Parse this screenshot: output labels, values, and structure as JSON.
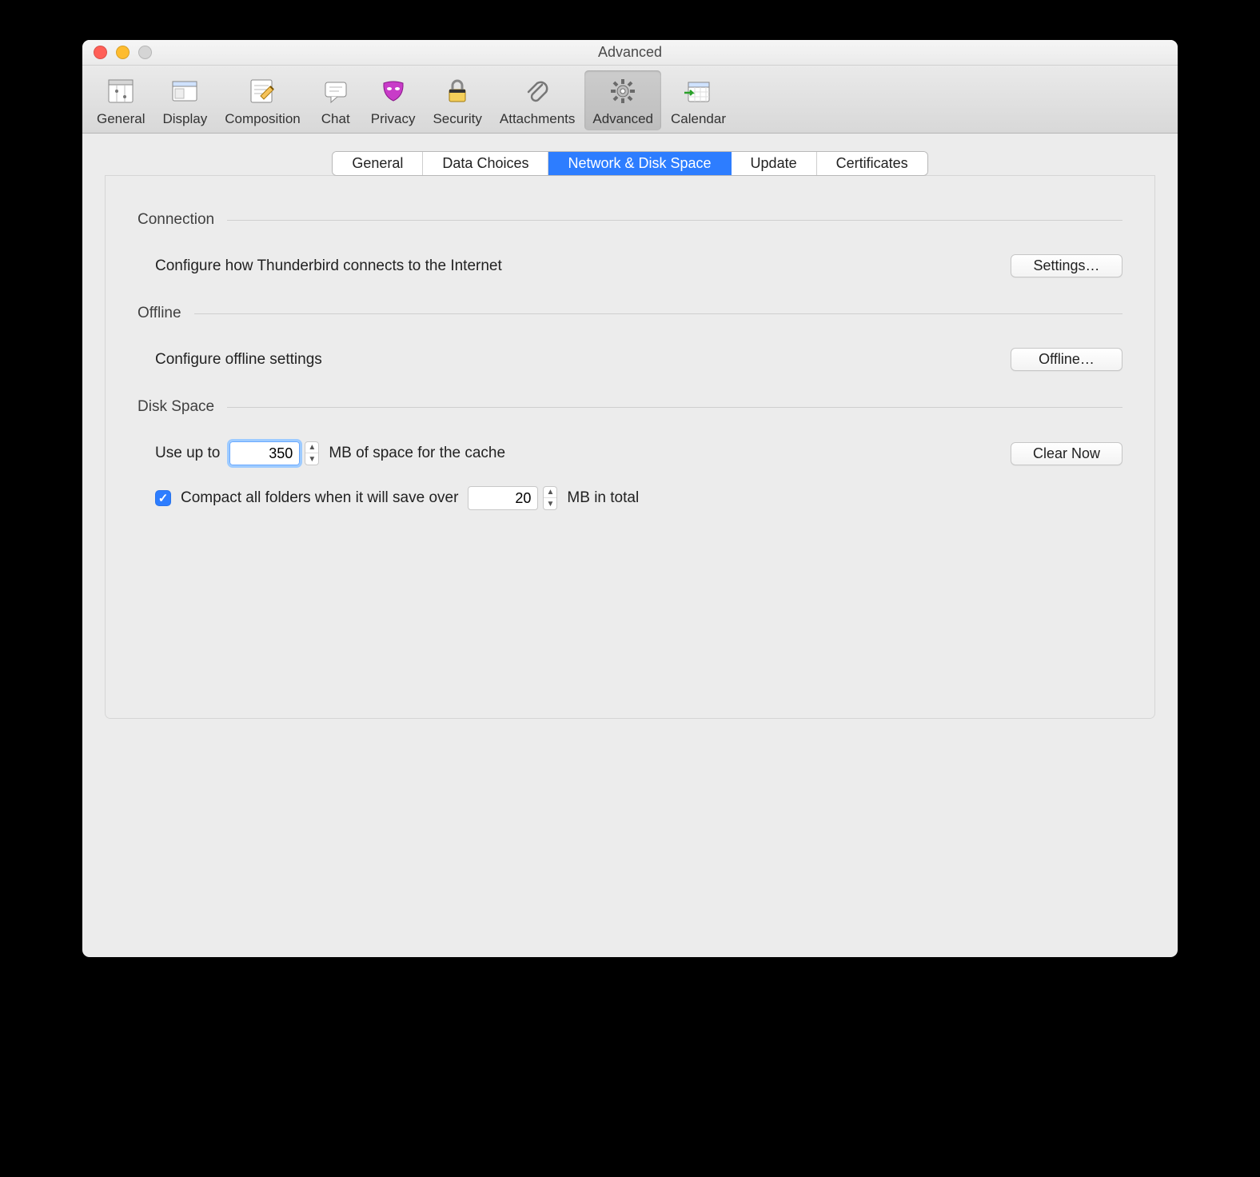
{
  "window": {
    "title": "Advanced"
  },
  "toolbar": [
    {
      "name": "general",
      "label": "General"
    },
    {
      "name": "display",
      "label": "Display"
    },
    {
      "name": "composition",
      "label": "Composition"
    },
    {
      "name": "chat",
      "label": "Chat"
    },
    {
      "name": "privacy",
      "label": "Privacy"
    },
    {
      "name": "security",
      "label": "Security"
    },
    {
      "name": "attachments",
      "label": "Attachments"
    },
    {
      "name": "advanced",
      "label": "Advanced",
      "selected": true
    },
    {
      "name": "calendar",
      "label": "Calendar"
    }
  ],
  "tabs": {
    "general": "General",
    "datachoices": "Data Choices",
    "network": "Network & Disk Space",
    "update": "Update",
    "certificates": "Certificates"
  },
  "sections": {
    "connection": {
      "heading": "Connection",
      "text": "Configure how Thunderbird connects to the Internet",
      "button": "Settings…"
    },
    "offline": {
      "heading": "Offline",
      "text": "Configure offline settings",
      "button": "Offline…"
    },
    "diskspace": {
      "heading": "Disk Space",
      "useupto_prefix": "Use up to",
      "useupto_suffix": "MB of space for the cache",
      "cache_value": "350",
      "clear_button": "Clear Now",
      "compact_label": "Compact all folders when it will save over",
      "compact_value": "20",
      "compact_suffix": "MB in total"
    }
  }
}
